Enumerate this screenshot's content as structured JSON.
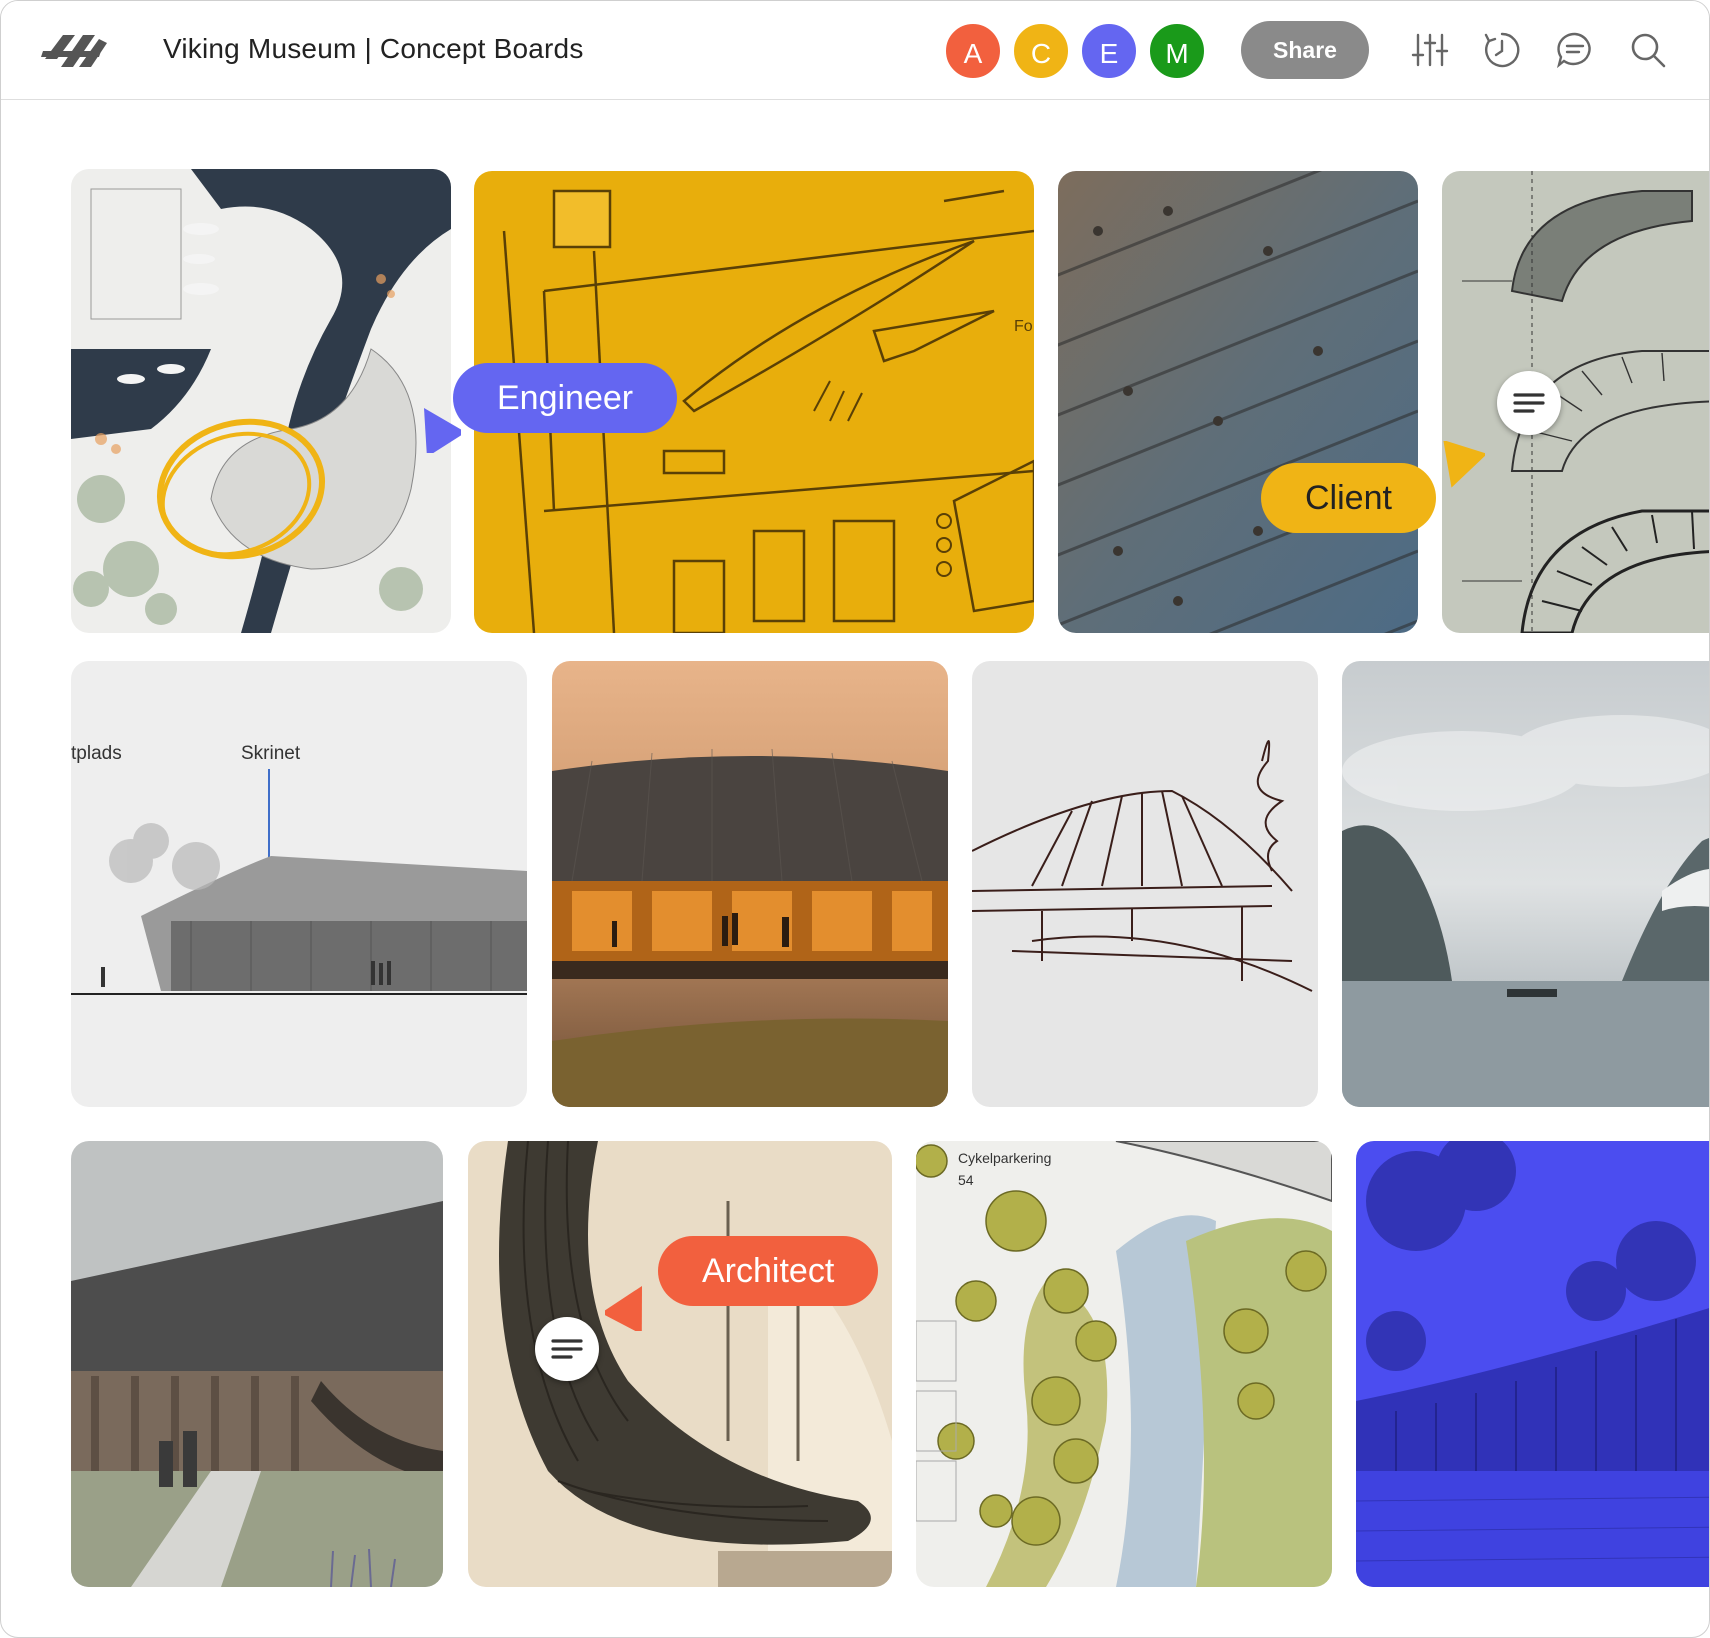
{
  "header": {
    "title": "Viking Museum | Concept Boards",
    "share_label": "Share"
  },
  "collaborators": [
    {
      "initial": "A",
      "color": "#f2603e"
    },
    {
      "initial": "C",
      "color": "#f0b415"
    },
    {
      "initial": "E",
      "color": "#6466f1"
    },
    {
      "initial": "M",
      "color": "#1a9a1a"
    }
  ],
  "tools": [
    "filter-sliders-icon",
    "history-clock-icon",
    "comments-icon",
    "search-icon"
  ],
  "tags": {
    "engineer": {
      "label": "Engineer",
      "color": "#6466f1"
    },
    "client": {
      "label": "Client",
      "color": "#f0b415"
    },
    "architect": {
      "label": "Architect",
      "color": "#f2603e"
    }
  },
  "images": {
    "sketch_section": {
      "label_left": "tplads",
      "label_right": "Skrinet"
    },
    "landscape_plan": {
      "label_top": "Cykelparkering",
      "label_num": "54"
    },
    "yellow_plan": {
      "label_right": "Fo"
    }
  }
}
